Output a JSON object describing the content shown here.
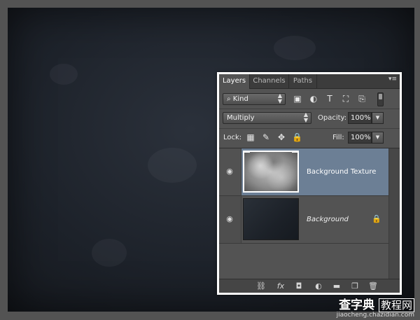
{
  "panel": {
    "tabs": [
      {
        "label": "Layers",
        "active": true
      },
      {
        "label": "Channels",
        "active": false
      },
      {
        "label": "Paths",
        "active": false
      }
    ],
    "menu_glyph": "▾≡",
    "filter": {
      "label": "Kind",
      "icons": [
        "image-filter-icon",
        "adjustment-filter-icon",
        "type-filter-icon",
        "shape-filter-icon",
        "smart-object-filter-icon"
      ]
    },
    "blend_mode": "Multiply",
    "opacity_label": "Opacity:",
    "opacity_value": "100%",
    "lock_label": "Lock:",
    "fill_label": "Fill:",
    "fill_value": "100%",
    "layers": [
      {
        "name": "Background Texture",
        "selected": true,
        "visible": true
      },
      {
        "name": "Background",
        "selected": false,
        "visible": true,
        "locked": true
      }
    ],
    "footer_icons": [
      "link-layers-icon",
      "fx-icon",
      "layer-mask-icon",
      "adjustment-layer-icon",
      "group-folder-icon",
      "new-layer-icon",
      "trash-icon"
    ]
  },
  "watermark": {
    "main_left": "查字典",
    "main_right": "教程网",
    "sub": "jiaocheng.chazidian.com"
  },
  "colors": {
    "selected_layer": "#6c7f95",
    "panel_bg": "#535353",
    "panel_border": "#ffffff",
    "canvas_dark": "#1d222a"
  }
}
